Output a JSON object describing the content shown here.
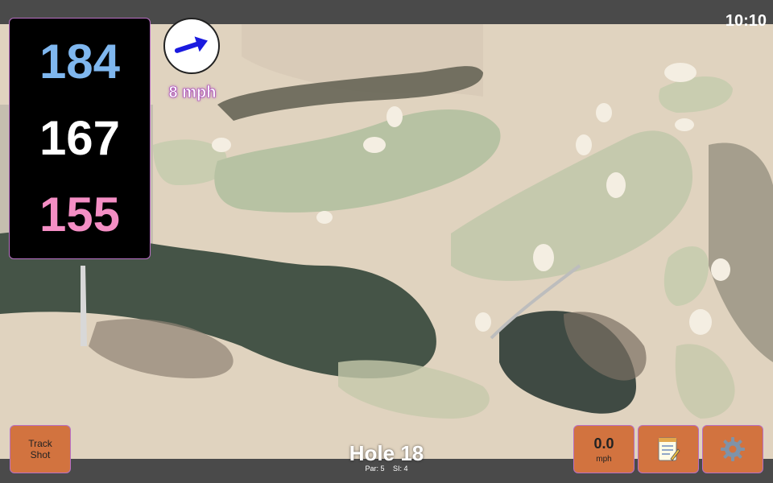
{
  "status": {
    "time": "10:10"
  },
  "distances": {
    "back": "184",
    "middle": "167",
    "front": "155"
  },
  "wind": {
    "speed": "8 mph",
    "icon": "wind-arrow-icon",
    "direction": "east-northeast"
  },
  "hole": {
    "title": "Hole 18",
    "par": "Par: 5",
    "si": "SI: 4"
  },
  "buttons": {
    "track_shot": "Track\nShot",
    "speed_value": "0.0",
    "speed_unit": "mph",
    "notes_icon": "notepad-icon",
    "settings_icon": "gear-icon"
  },
  "colors": {
    "accent_button": "#d2733f",
    "back_distance": "#7fb7ef",
    "middle_distance": "#ffffff",
    "front_distance": "#f48ec4",
    "wind_arrow": "#1a1adf"
  }
}
